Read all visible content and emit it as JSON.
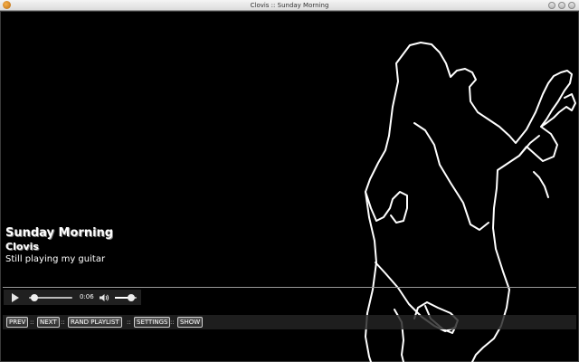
{
  "window": {
    "title": "Clovis :: Sunday Morning"
  },
  "song": {
    "title": "Sunday Morning",
    "artist": "Clovis",
    "comment": "Still playing my guitar"
  },
  "player": {
    "time": "0:06",
    "progress": 0.13,
    "volume": 0.75
  },
  "nav": {
    "prev": "PREV",
    "next": "NEXT",
    "rand_playlist": "RAND PLAYLIST",
    "settings": "SETTINGS",
    "show": "SHOW",
    "separator": "::"
  },
  "icons": {
    "app": "app-icon",
    "play": "play-icon",
    "volume": "speaker-icon",
    "artwork": "guitarist-silhouette"
  },
  "colors": {
    "background": "#000000",
    "outline": "#ffffff",
    "bar": "#262626"
  }
}
